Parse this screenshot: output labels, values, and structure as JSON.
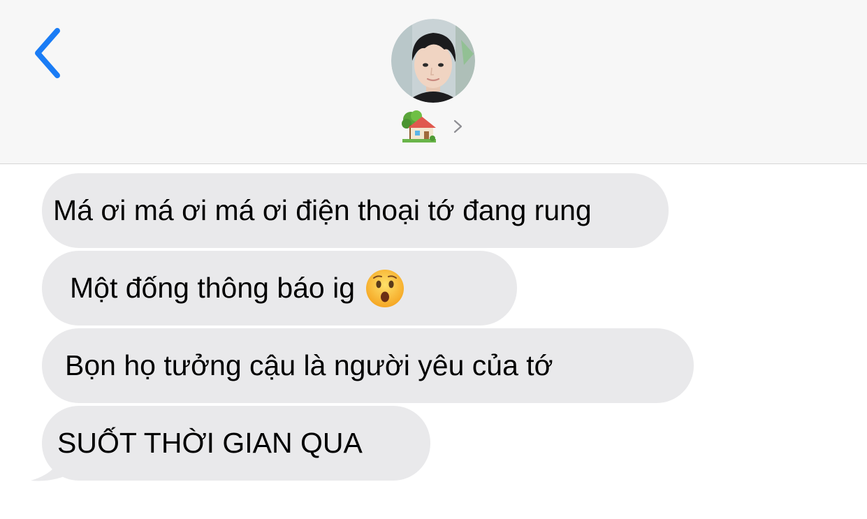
{
  "header": {
    "back_icon": "chevron-left-icon",
    "contact_emoji": "house-with-garden-icon",
    "details_icon": "chevron-right-icon"
  },
  "messages": [
    {
      "text": "Má ơi má ơi má ơi điện thoại tớ đang rung",
      "emoji": ""
    },
    {
      "text": "Một đống thông báo ig",
      "emoji": "hushed-face-icon"
    },
    {
      "text": "Bọn họ tưởng cậu là người yêu của tớ",
      "emoji": ""
    },
    {
      "text": "SUỐT THỜI GIAN QUA",
      "emoji": ""
    }
  ],
  "colors": {
    "accent": "#1a7cf5",
    "bubble": "#e9e9eb",
    "header_bg": "#f7f7f7"
  }
}
